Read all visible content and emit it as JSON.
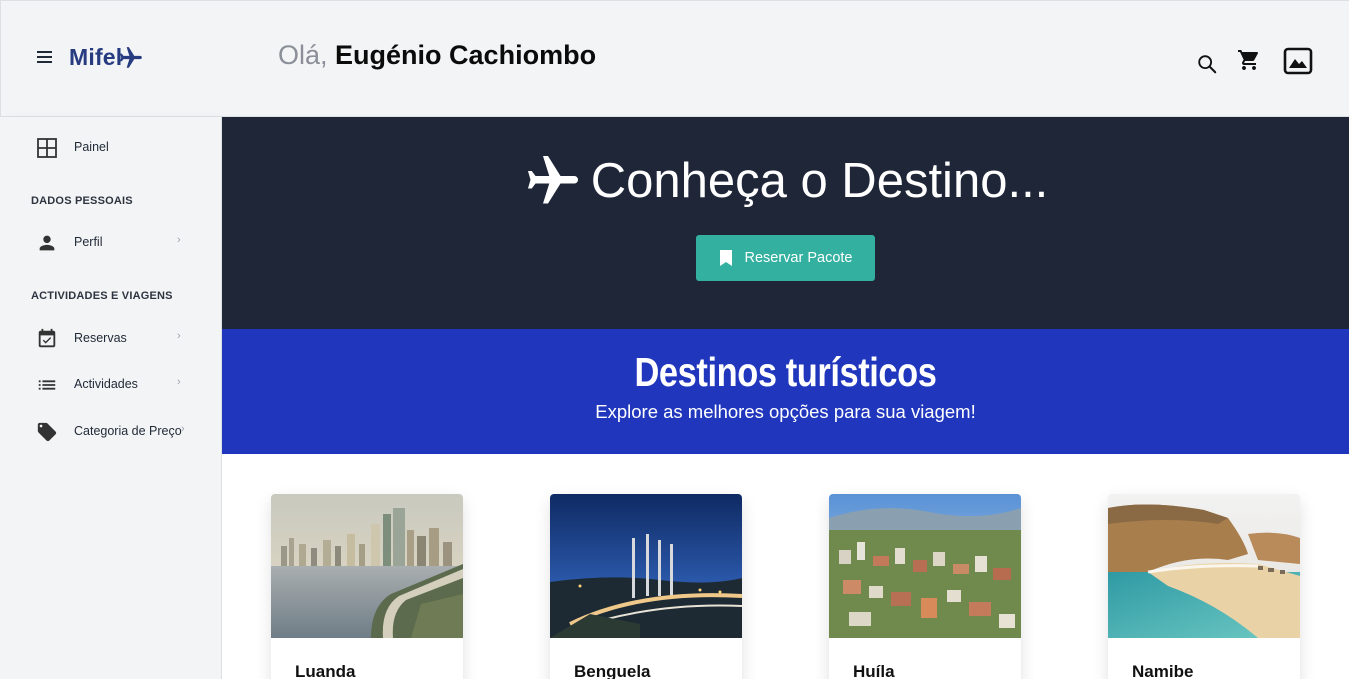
{
  "header": {
    "logo_text": "Mifel",
    "greeting_hello": "Olá,",
    "greeting_name": "Eugénio Cachiombo"
  },
  "sidebar": {
    "painel": "Painel",
    "section_personal": "DADOS PESSOAIS",
    "perfil": "Perfil",
    "section_activities": "ACTIVIDADES E VIAGENS",
    "reservas": "Reservas",
    "actividades": "Actividades",
    "categoria": "Categoria de Preço",
    "chevron": "›"
  },
  "hero": {
    "title": "Conheça o Destino...",
    "button_label": "Reservar Pacote"
  },
  "band": {
    "title": "Destinos turísticos",
    "subtitle": "Explore as melhores opções para sua viagem!"
  },
  "destinations": [
    {
      "name": "Luanda"
    },
    {
      "name": "Benguela"
    },
    {
      "name": "Huíla"
    },
    {
      "name": "Namibe"
    }
  ],
  "colors": {
    "hero_bg": "#1e2638",
    "band_bg": "#1f36bd",
    "button_bg": "#33b0a0",
    "logo": "#263b80"
  }
}
